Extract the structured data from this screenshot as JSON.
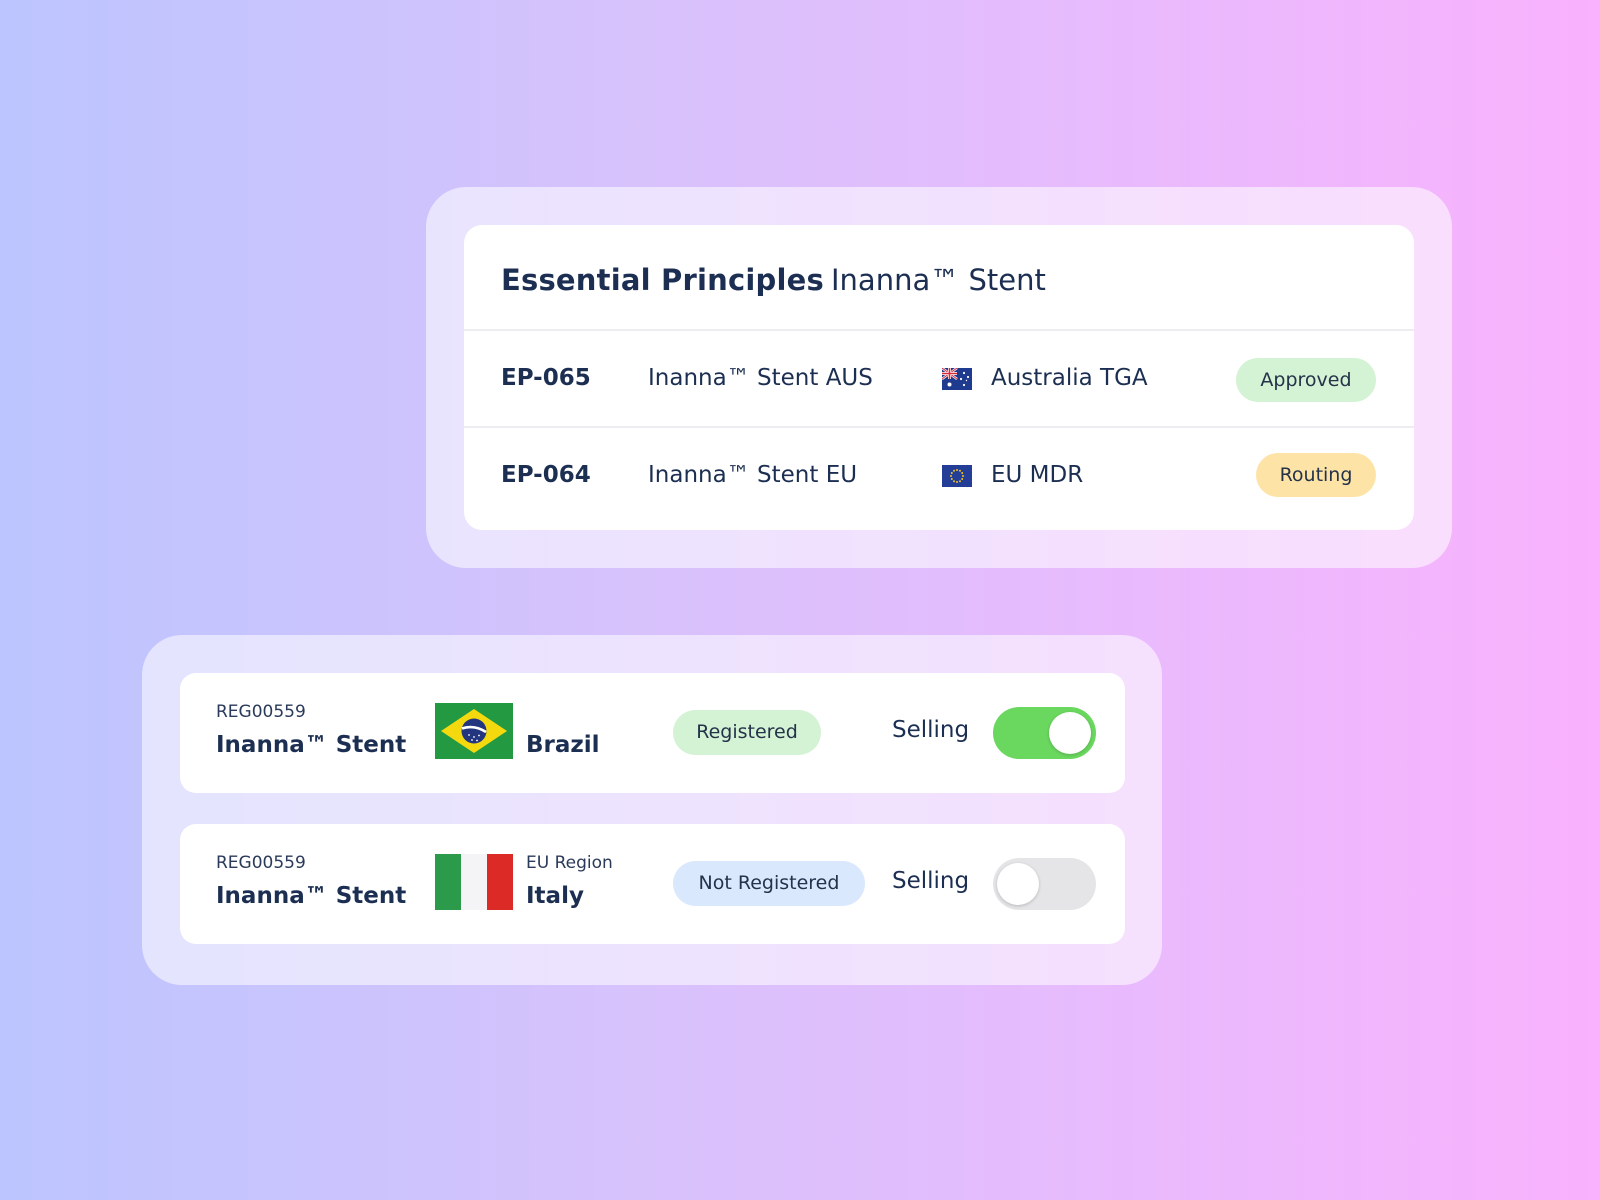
{
  "essential_principles": {
    "title": "Essential Principles",
    "product": "Inanna™ Stent",
    "rows": [
      {
        "id": "EP-065",
        "name": "Inanna™ Stent AUS",
        "flag_icon": "australia-flag-icon",
        "region": "Australia TGA",
        "status": "Approved",
        "status_color": "#d4f2d4"
      },
      {
        "id": "EP-064",
        "name": "Inanna™ Stent EU",
        "flag_icon": "eu-flag-icon",
        "region": "EU MDR",
        "status": "Routing",
        "status_color": "#fde4a6"
      }
    ]
  },
  "registrations": [
    {
      "code": "REG00559",
      "product": "Inanna™ Stent",
      "flag_icon": "brazil-flag-icon",
      "subregion": "",
      "country": "Brazil",
      "status": "Registered",
      "status_color": "#d4f2d4",
      "selling_label": "Selling",
      "selling": true
    },
    {
      "code": "REG00559",
      "product": "Inanna™ Stent",
      "flag_icon": "italy-flag-icon",
      "subregion": "EU Region",
      "country": "Italy",
      "status": "Not Registered",
      "status_color": "#d9e8fd",
      "selling_label": "Selling",
      "selling": false
    }
  ],
  "colors": {
    "text_primary": "#1c2f52",
    "toggle_on": "#6ad75f",
    "toggle_off": "#e5e5e8"
  }
}
